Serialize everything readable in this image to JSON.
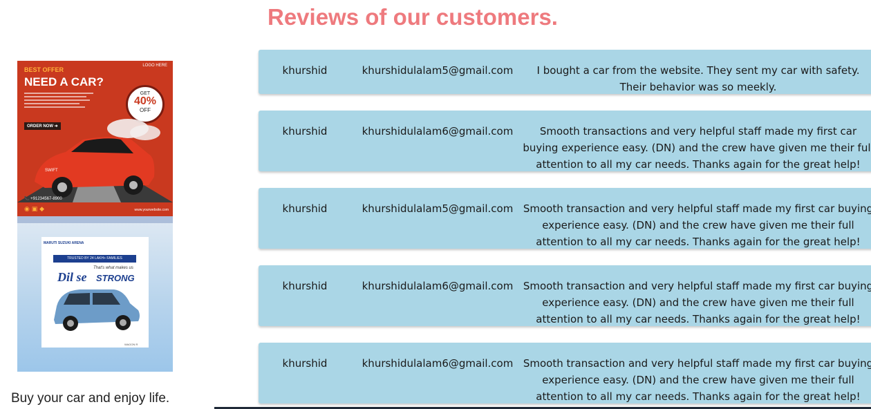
{
  "page": {
    "heading": "Reviews of our customers.",
    "tagline": "Buy your car and enjoy life."
  },
  "ad_offer": {
    "best_offer": "BEST OFFER",
    "headline": "NEED A CAR?",
    "logo_text": "LOGO HERE",
    "order_button": "ORDER NOW",
    "badge_get": "GET",
    "badge_percent": "40%",
    "badge_off": "OFF",
    "call_text": "+91234567-8900",
    "website": "www.yourwebsite.com",
    "car_model": "SWIFT"
  },
  "ad_maruti": {
    "brand": "MARUTI SUZUKI ARENA",
    "ribbon": "TRUSTED BY 24 LAKH+ FAMILIES",
    "that_text": "That's what makes us",
    "slogan_script": "Dil se",
    "slogan_bold": "STRONG",
    "footer": "WAGON R"
  },
  "colors": {
    "heading": "#ee7a7e",
    "card_background": "#aad6e6",
    "ad_red": "#c9391f",
    "brand_blue": "#1c3f8f"
  },
  "reviews": [
    {
      "name": "khurshid",
      "email": "khurshidulalam5@gmail.com",
      "text": "I bought a car from the website. They sent my car with safety. Their behavior was so meekly."
    },
    {
      "name": "khurshid",
      "email": "khurshidulalam6@gmail.com",
      "text": "Smooth transactions and very helpful staff made my first car buying experience easy. (DN) and the crew have given me their full attention to all my car needs. Thanks again for the great help!"
    },
    {
      "name": "khurshid",
      "email": "khurshidulalam5@gmail.com",
      "text": "Smooth transaction and very helpful staff made my first car buying experience easy. (DN) and the crew have given me their full attention to all my car needs. Thanks again for the great help!"
    },
    {
      "name": "khurshid",
      "email": "khurshidulalam6@gmail.com",
      "text": "Smooth transaction and very helpful staff made my first car buying experience easy. (DN) and the crew have given me their full attention to all my car needs. Thanks again for the great help!"
    },
    {
      "name": "khurshid",
      "email": "khurshidulalam6@gmail.com",
      "text": "Smooth transaction and very helpful staff made my first car buying experience easy. (DN) and the crew have given me their full attention to all my car needs. Thanks again for the great help!"
    }
  ]
}
